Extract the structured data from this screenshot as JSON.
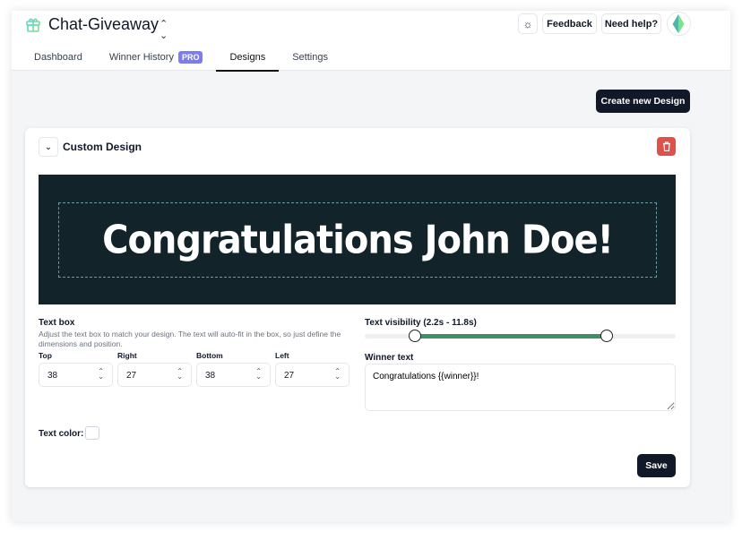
{
  "app": {
    "title": "Chat-Giveaway",
    "logo_icon": "gift-icon"
  },
  "tabs": [
    {
      "label": "Dashboard"
    },
    {
      "label": "Winner History",
      "badge": "PRO"
    },
    {
      "label": "Designs",
      "active": true
    },
    {
      "label": "Settings"
    }
  ],
  "header": {
    "feedback": "Feedback",
    "help": "Need help?",
    "theme_icon": "sun-icon"
  },
  "main": {
    "create_label": "Create new Design"
  },
  "design": {
    "name": "Custom Design",
    "preview_text": "Congratulations John Doe!",
    "text_box": {
      "label": "Text box",
      "help": "Adjust the text box to match your design. The text will auto-fit in the box, so just define the dimensions and position.",
      "fields": [
        {
          "label": "Top",
          "value": "38"
        },
        {
          "label": "Right",
          "value": "27"
        },
        {
          "label": "Bottom",
          "value": "38"
        },
        {
          "label": "Left",
          "value": "27"
        }
      ]
    },
    "visibility": {
      "label": "Text visibility (2.2s - 11.8s)",
      "start": 2.2,
      "end": 11.8
    },
    "winner_text": {
      "label": "Winner text",
      "value": "Congratulations {{winner}}!"
    },
    "text_color": {
      "label": "Text color:",
      "value": "#ffffff"
    },
    "save_label": "Save"
  },
  "colors": {
    "primary": "#111827",
    "danger": "#e0514b",
    "slider": "#3e8f62",
    "pro": "#7c7cf0",
    "banner": "#12242a"
  }
}
